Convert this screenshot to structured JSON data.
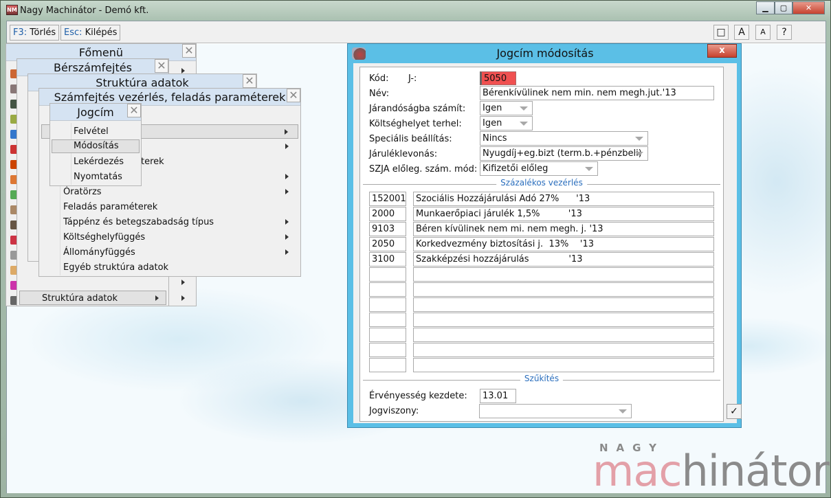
{
  "window": {
    "title": "Nagy Machinátor - Demó kft.",
    "app_icon": "NM",
    "minimize": "▁",
    "maximize": "▢",
    "close": "✕"
  },
  "toolbar": {
    "delete_key": "F3:",
    "delete_label": "Törlés",
    "exit_key": "Esc:",
    "exit_label": "Kilépés",
    "window_icon": "□",
    "font_large": "A",
    "font_small": "A",
    "help": "?"
  },
  "menus": {
    "fomenu": {
      "title": "Főmenü",
      "close": "✕"
    },
    "berszamfejtes": {
      "title": "Bérszámfejtés",
      "close": "✕",
      "item": "Struktúra adatok"
    },
    "struktura": {
      "title": "Struktúra adatok",
      "close": "✕"
    },
    "szamfejtes": {
      "title": "Számfejtés vezérlés, feladás paraméterek",
      "close": "✕",
      "fragment": "terek",
      "items": [
        "Óratörzs",
        "Feladás paraméterek",
        "Táppénz és betegszabadság típus",
        "Költséghelyfüggés",
        "Állományfüggés",
        "Egyéb struktúra adatok"
      ]
    },
    "jogcim": {
      "title": "Jogcím",
      "close": "✕",
      "items": [
        "Felvétel",
        "Módosítás",
        "Lekérdezés",
        "Nyomtatás"
      ]
    }
  },
  "dialog": {
    "title": "Jogcím módosítás",
    "close": "x",
    "kod_label": "Kód:",
    "kod_prefix": "J-:",
    "kod": "5050",
    "nev_label": "Név:",
    "nev": "Bérenkívülinek nem min. nem megh.jut.'13",
    "jarandosag_label": "Járandóságba számít:",
    "jarandosag": "Igen",
    "koltseghely_label": "Költséghelyet terhel:",
    "koltseghely": "Igen",
    "specialis_label": "Speciális beállítás:",
    "specialis": "Nincs",
    "jarulek_label": "Járuléklevonás:",
    "jarulek": "Nyugdíj+eg.bizt (term.b.+pénzbeli)",
    "szja_label": "SZJA előleg. szám. mód:",
    "szja": "Kifizetői előleg",
    "section_percent": "Százalékos vezérlés",
    "rows": [
      {
        "code": "152001",
        "name": "Szociális Hozzájárulási Adó 27%      '13"
      },
      {
        "code": "2000",
        "name": "Munkaerőpiaci járulék 1,5%          '13"
      },
      {
        "code": "9103",
        "name": "Béren kívülinek nem mi. nem megh. j. '13"
      },
      {
        "code": "2050",
        "name": "Korkedvezmény biztosítási j.  13%    '13"
      },
      {
        "code": "3100",
        "name": "Szakképzési hozzájárulás              '13"
      },
      {
        "code": "",
        "name": ""
      },
      {
        "code": "",
        "name": ""
      },
      {
        "code": "",
        "name": ""
      },
      {
        "code": "",
        "name": ""
      },
      {
        "code": "",
        "name": ""
      },
      {
        "code": "",
        "name": ""
      },
      {
        "code": "",
        "name": ""
      }
    ],
    "section_filter": "Szűkítés",
    "ervenyesseg_label": "Érvényesség kezdete:",
    "ervenyesseg": "13.01",
    "jogviszony_label": "Jogviszony:",
    "jogviszony": "",
    "ok": "✓"
  },
  "logo": {
    "top": "NAGY",
    "brand_a": "mac",
    "brand_b": "hinátor"
  },
  "colors": {
    "accent": "#5bbfe6",
    "kod_bg": "#f05050",
    "section": "#2a6ebd"
  }
}
